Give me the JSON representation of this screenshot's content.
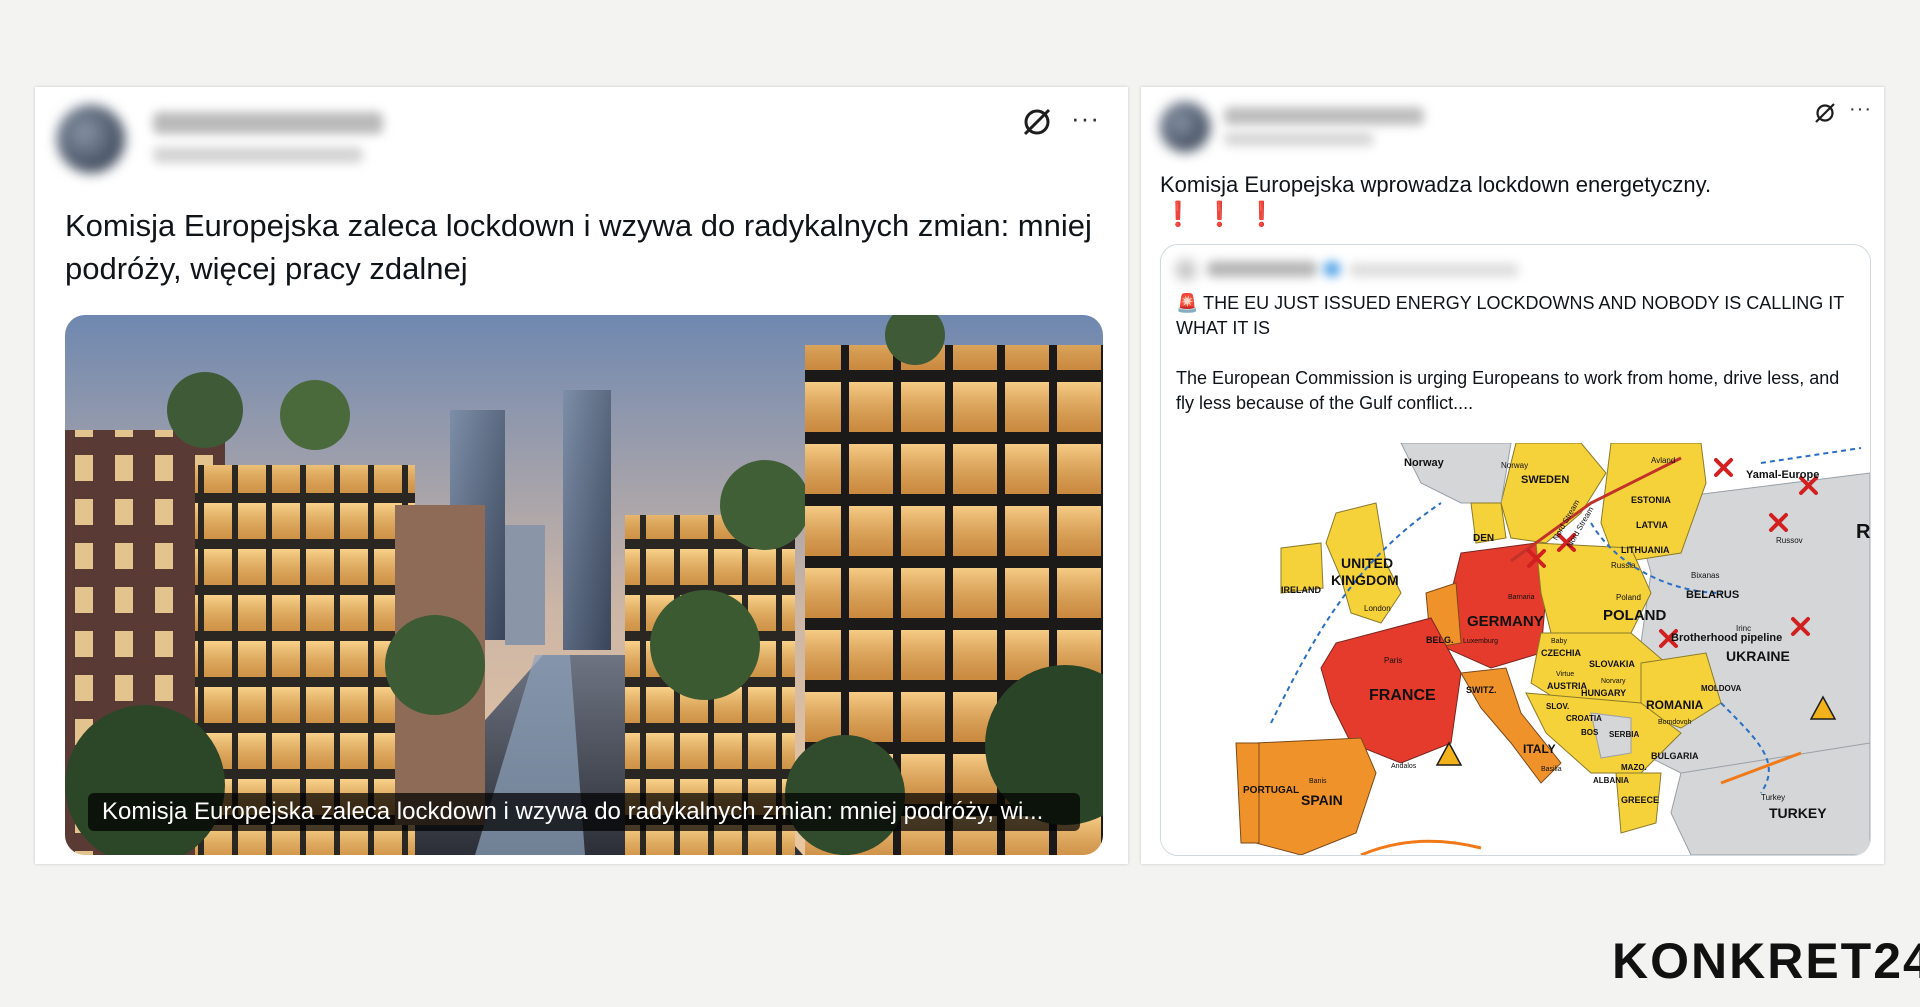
{
  "left_post": {
    "text": "Komisja Europejska zaleca lockdown i wzywa do radykalnych zmian: mniej podróży, więcej pracy zdalnej",
    "media_caption": "Komisja Europejska zaleca lockdown i wzywa do radykalnych zmian: mniej podróży, wi..."
  },
  "right_post": {
    "text": "Komisja Europejska wprowadza lockdown energetyczny.",
    "marks": "❗❗❗",
    "quote": {
      "headline": "🚨 THE EU JUST ISSUED ENERGY LOCKDOWNS AND NOBODY IS CALLING IT WHAT IT IS",
      "body": "The European Commission is urging Europeans to work from home, drive less, and fly less because of the Gulf conflict....",
      "map_labels": {
        "norway": "Norway",
        "norway_small": "Norway",
        "sweden": "SWEDEN",
        "avland": "Avland",
        "yamal": "Yamal-Europe",
        "estonia": "ESTONIA",
        "latvia": "LATVIA",
        "lithuania": "LITHUANIA",
        "russov": "Russov",
        "russia": "Russia",
        "nord1": "Nord Stream",
        "nord2": "Nord Stream",
        "den": "DEN",
        "uk1": "UNITED",
        "uk2": "KINGDOM",
        "ireland": "IRELAND",
        "london": "London",
        "germany": "GERMANY",
        "berlin": "Barnaria",
        "luxemburg": "Luxemburg",
        "belg": "BELG.",
        "poland": "POLAND",
        "poland_small": "Poland",
        "belarus": "BELARUS",
        "bixanas": "Bixanas",
        "brotherhood": "Brotherhood pipeline",
        "ukraine": "UKRAINE",
        "irinc": "Irinc",
        "czechia": "CZECHIA",
        "baby": "Baby",
        "virtue": "Virtue",
        "slovakia": "SLOVAKIA",
        "austria": "AUSTRIA",
        "hungary": "HUNGARY",
        "norvary": "Norvary",
        "moldova": "MOLDOVA",
        "france": "FRANCE",
        "paris": "Paris",
        "switz": "SWITZ.",
        "slov": "SLOV.",
        "croatia": "CROATIA",
        "romania": "ROMANIA",
        "bomdovoh": "Bomdovoh",
        "serbia": "SERBIA",
        "bos": "BOS",
        "bulgaria": "BULGARIA",
        "italy": "ITALY",
        "basilia": "Basilia",
        "mazo": "MAZO.",
        "albania": "ALBANIA",
        "greece": "GREECE",
        "portugal": "PORTUGAL",
        "spain": "SPAIN",
        "banis": "Banis",
        "andalos": "Andalos",
        "turkey": "TURKEY",
        "turkey_small": "Turkey",
        "r": "R"
      },
      "colors": {
        "red": "#e53b2c",
        "orange": "#f0922a",
        "yellow": "#f6d23a",
        "grey": "#d4d6d8",
        "sea": "#ffffff"
      }
    }
  },
  "brand": {
    "logo": "KONKRET24"
  }
}
